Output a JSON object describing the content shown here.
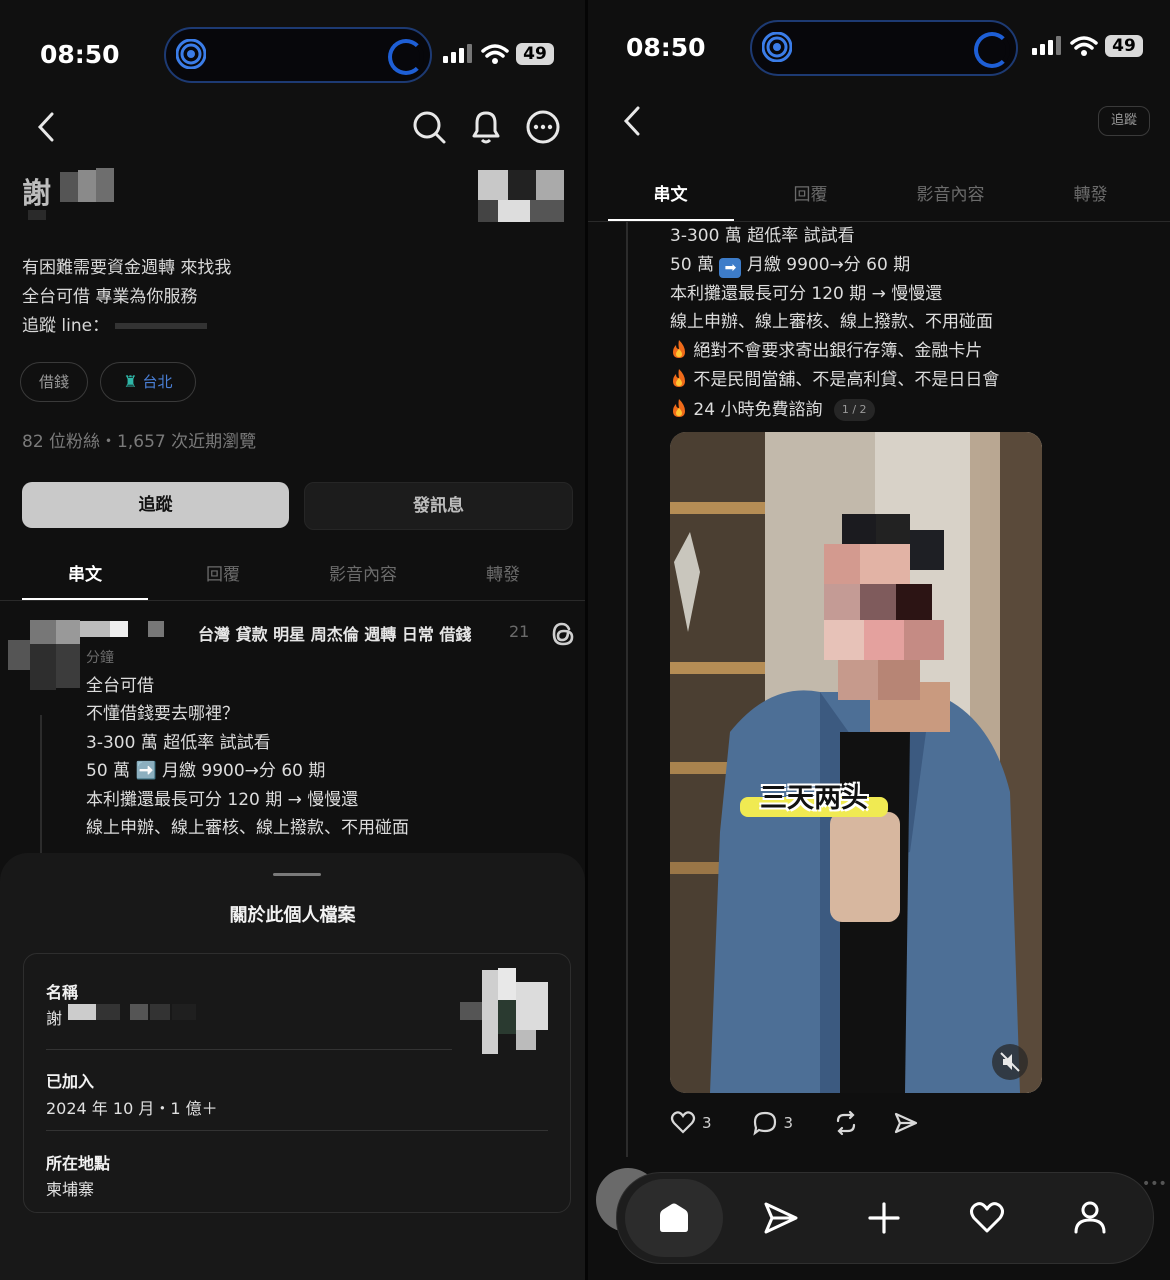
{
  "status": {
    "time": "08:50",
    "battery": "49"
  },
  "profile": {
    "name_visible": "謝",
    "bio_lines": [
      "有困難需要資金週轉 來找我",
      "全台可借 專業為你服務",
      "追蹤 line："
    ],
    "tags": [
      "借錢",
      "台北"
    ],
    "stats": "82 位粉絲・1,657 次近期瀏覽",
    "follow_button": "追蹤",
    "message_button": "發訊息"
  },
  "tabs": [
    "串文",
    "回覆",
    "影音內容",
    "轉發"
  ],
  "left_post": {
    "header": "台灣 貸款 明星 周杰倫  週轉 日常 借錢",
    "time_a": "21",
    "time_b": "分鐘",
    "lines": [
      "全台可借",
      "不懂借錢要去哪裡？",
      "3-300 萬 超低率 試試看",
      "50 萬 ➡️ 月繳 9900→分 60 期",
      "本利攤還最長可分 120 期 → 慢慢還",
      "線上申辦、線上審核、線上撥款、不用碰面"
    ]
  },
  "sheet": {
    "title": "關於此個人檔案",
    "name_label": "名稱",
    "name_value": "謝",
    "joined_label": "已加入",
    "joined_value": "2024 年 10 月・1 億＋",
    "location_label": "所在地點",
    "location_value": "柬埔寨"
  },
  "right": {
    "follow_small": "追蹤",
    "lines": [
      "3-300 萬 超低率 試試看",
      "50 萬",
      "月繳 9900→分 60 期",
      "本利攤還最長可分 120 期 → 慢慢還",
      "線上申辦、線上審核、線上撥款、不用碰面",
      "絕對不會要求寄出銀行存簿、金融卡片",
      "不是民間當舖、不是高利貸、不是日日會",
      "24 小時免費諮詢"
    ],
    "page_indicator": "1 / 2",
    "video_caption": "三天两头",
    "likes": "3",
    "comments": "3"
  },
  "icons": [
    "back-icon",
    "search-icon",
    "bell-icon",
    "more-icon",
    "threads-icon",
    "home-icon",
    "send-icon",
    "plus-icon",
    "heart-icon",
    "person-icon",
    "repost-icon",
    "comment-icon",
    "mute-icon"
  ]
}
